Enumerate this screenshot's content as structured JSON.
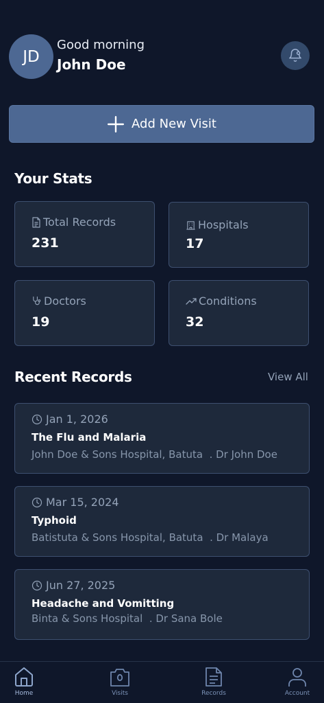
{
  "header": {
    "avatar_initials": "JD",
    "greeting": "Good morning",
    "user_name": "John Doe",
    "notification_icon": "bell-icon"
  },
  "actions": {
    "add_visit_label": "Add New Visit",
    "add_visit_icon": "plus-icon"
  },
  "stats": {
    "title": "Your Stats",
    "items": [
      {
        "label": "Total Records",
        "value": "231",
        "icon": "document-icon"
      },
      {
        "label": "Hospitals",
        "value": "17",
        "icon": "building-icon"
      },
      {
        "label": "Doctors",
        "value": "19",
        "icon": "stethoscope-icon"
      },
      {
        "label": "Conditions",
        "value": "32",
        "icon": "trending-up-icon"
      }
    ]
  },
  "recent": {
    "title": "Recent Records",
    "view_all": "View All",
    "records": [
      {
        "date": "Jan 1, 2026",
        "title": "The Flu and Malaria",
        "hospital": "John Doe & Sons Hospital, Batuta",
        "doctor": ". Dr John Doe"
      },
      {
        "date": "Mar 15, 2024",
        "title": "Typhoid",
        "hospital": "Batistuta & Sons Hospital, Batuta",
        "doctor": ". Dr Malaya"
      },
      {
        "date": "Jun 27, 2025",
        "title": "Headache and Vomitting",
        "hospital": "Binta & Sons Hospital",
        "doctor": ". Dr Sana Bole"
      }
    ]
  },
  "nav": {
    "items": [
      {
        "label": "Home",
        "icon": "home-icon",
        "active": true
      },
      {
        "label": "Visits",
        "icon": "camera-icon",
        "active": false
      },
      {
        "label": "Records",
        "icon": "file-text-icon",
        "active": false
      },
      {
        "label": "Account",
        "icon": "user-icon",
        "active": false
      }
    ]
  },
  "colors": {
    "background": "#0f172a",
    "card": "#1e293b",
    "card_border": "#3e5070",
    "accent": "#4d6893",
    "muted_text": "#94a3b8"
  }
}
